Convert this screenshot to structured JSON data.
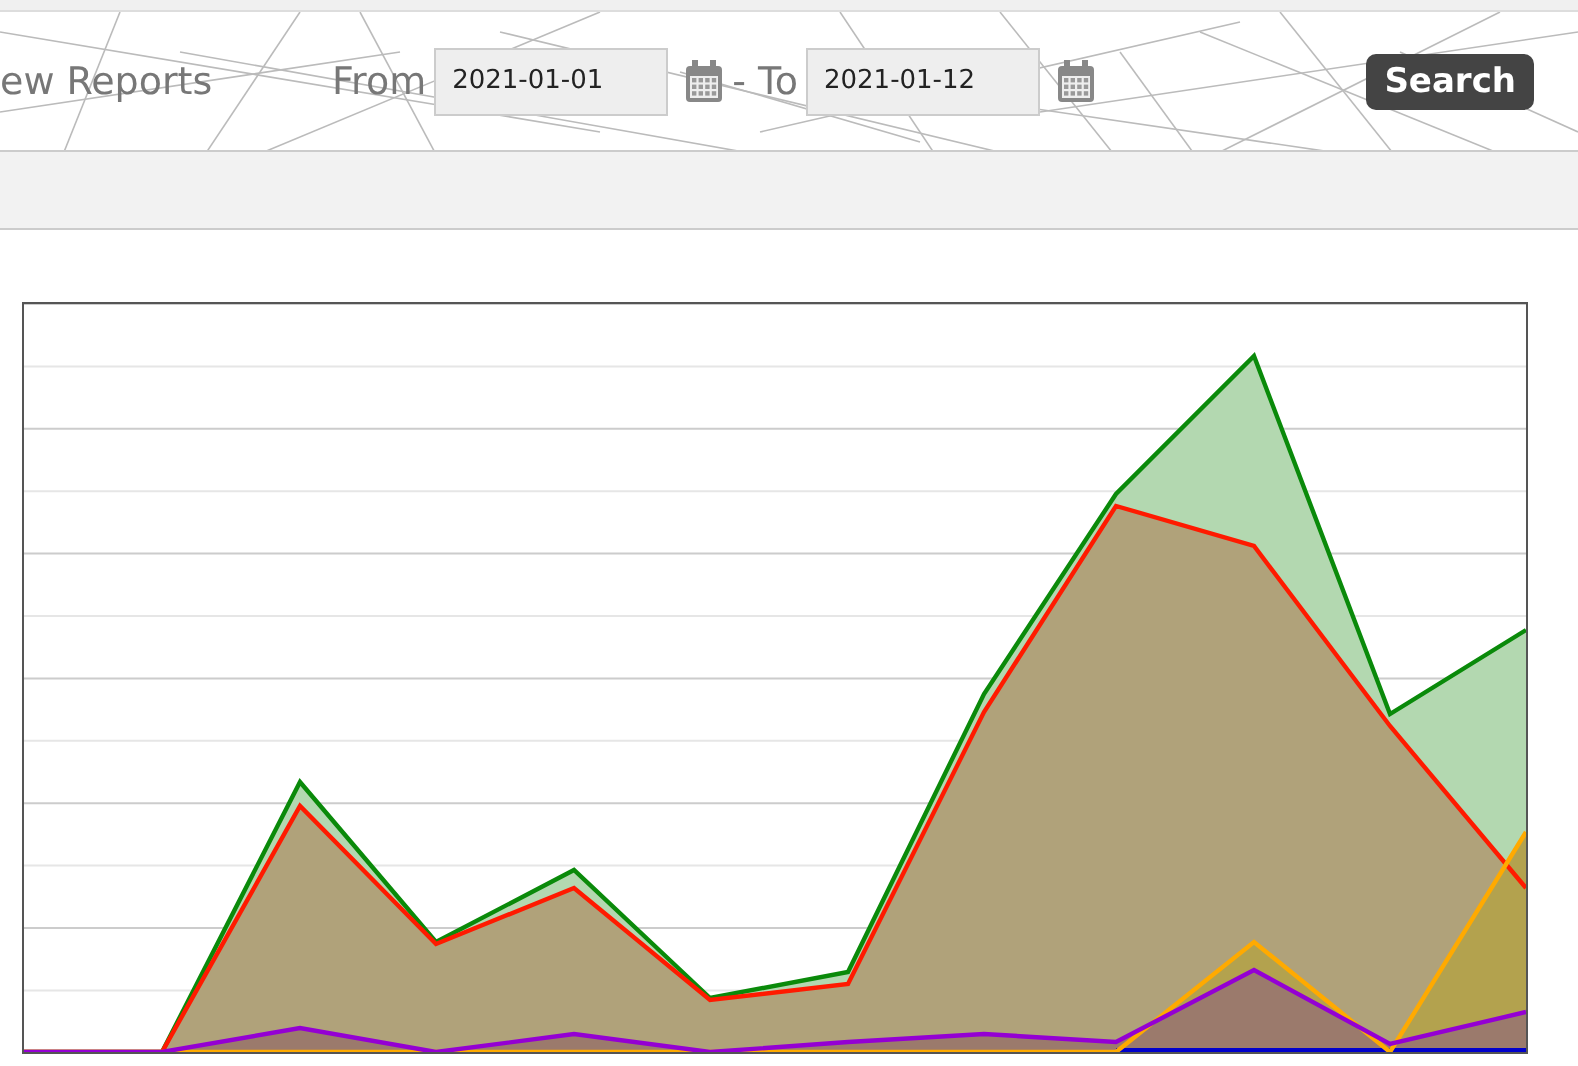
{
  "header": {
    "title": "ew Reports",
    "from_label": "From",
    "from_date": "2021-01-01",
    "to_label": "- To",
    "to_date": "2021-01-12",
    "search_button": "Search"
  }
}
